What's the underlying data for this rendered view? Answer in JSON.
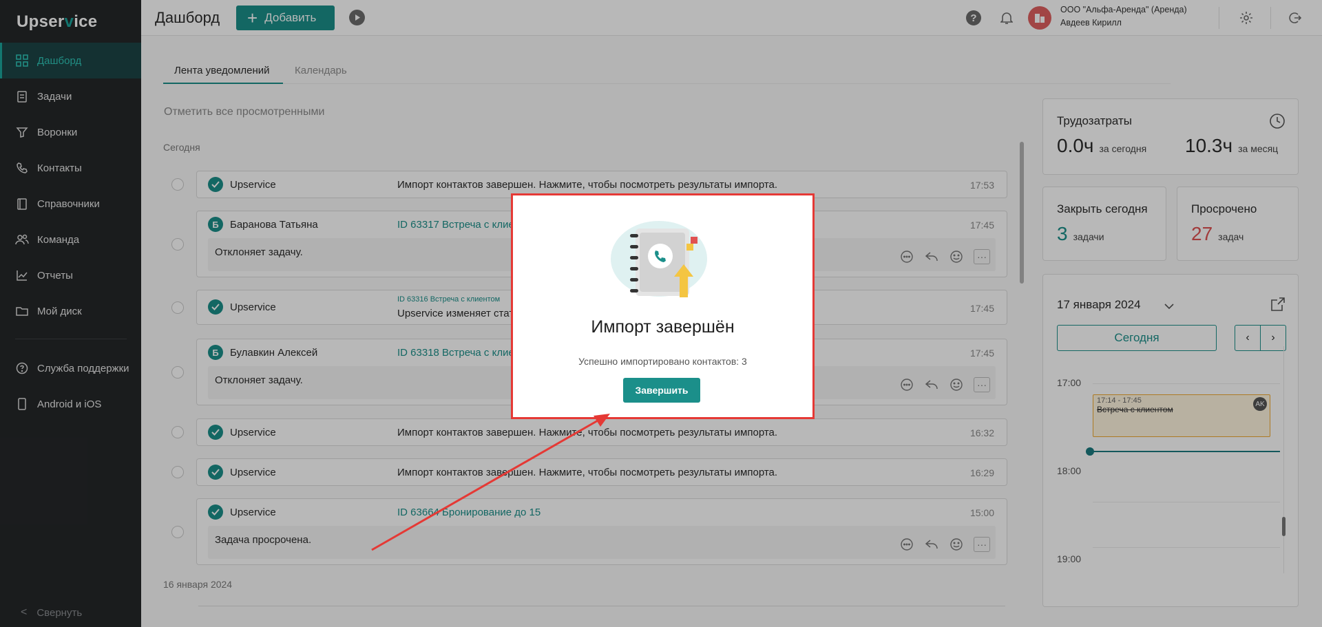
{
  "app": {
    "logo_prefix": "Upser",
    "logo_check": "v",
    "logo_suffix": "ice"
  },
  "sidebar": {
    "items": [
      {
        "label": "Дашборд"
      },
      {
        "label": "Задачи"
      },
      {
        "label": "Воронки"
      },
      {
        "label": "Контакты"
      },
      {
        "label": "Справочники"
      },
      {
        "label": "Команда"
      },
      {
        "label": "Отчеты"
      },
      {
        "label": "Мой диск"
      },
      {
        "label": "Служба поддержки"
      },
      {
        "label": "Android и iOS"
      }
    ],
    "collapse_label": "Свернуть",
    "collapse_arrow": "<"
  },
  "header": {
    "title": "Дашборд",
    "add_label": "Добавить",
    "add_plus": "+",
    "help_glyph": "?",
    "org_name": "ООО \"Альфа-Аренда\" (Аренда)",
    "user_name": "Авдеев Кирилл"
  },
  "tabs": [
    {
      "label": "Лента уведомлений"
    },
    {
      "label": "Календарь"
    }
  ],
  "feed": {
    "mark_all_label": "Отметить все просмотренными",
    "group_today": "Сегодня",
    "group_prev": "16 января 2024",
    "items": [
      {
        "sender": "Upservice",
        "message": "Импорт контактов завершен. Нажмите, чтобы посмотреть результаты импорта.",
        "time": "17:53"
      },
      {
        "sender_initial": "Б",
        "sender": "Баранова Татьяна",
        "message": "ID 63317 Встреча с клие",
        "time": "17:45",
        "body": "Отклоняет задачу."
      },
      {
        "sender": "Upservice",
        "sub": "ID 63316 Встреча с клиентом",
        "message": "Upservice изменяет стат",
        "time": "17:45"
      },
      {
        "sender_initial": "Б",
        "sender": "Булавкин Алексей",
        "message": "ID 63318 Встреча с клие",
        "time": "17:45",
        "body": "Отклоняет задачу."
      },
      {
        "sender": "Upservice",
        "message": "Импорт контактов завершен. Нажмите, чтобы посмотреть результаты импорта.",
        "time": "16:32"
      },
      {
        "sender": "Upservice",
        "message": "Импорт контактов завершен. Нажмите, чтобы посмотреть результаты импорта.",
        "time": "16:29"
      },
      {
        "sender": "Upservice",
        "message": "ID 63664 Бронирование до 15",
        "time": "15:00",
        "body": "Задача просрочена."
      }
    ],
    "more_glyph": "···"
  },
  "widgets": {
    "labor": {
      "title": "Трудозатраты",
      "today_value": "0.0ч",
      "today_label": "за сегодня",
      "month_value": "10.3ч",
      "month_label": "за месяц"
    },
    "close_today": {
      "title": "Закрыть сегодня",
      "value": "3",
      "unit": "задачи"
    },
    "overdue": {
      "title": "Просрочено",
      "value": "27",
      "unit": "задач"
    },
    "calendar": {
      "date": "17 января 2024",
      "today_label": "Сегодня",
      "prev_glyph": "‹",
      "next_glyph": "›",
      "hours": [
        "17:00",
        "18:00",
        "19:00"
      ],
      "event": {
        "time": "17:14 - 17:45",
        "title": "Встреча с клиентом",
        "badge": "AK"
      }
    }
  },
  "modal": {
    "title": "Импорт завершён",
    "text": "Успешно импортировано контактов: 3",
    "button": "Завершить"
  },
  "colors": {
    "accent": "#1b8f8a",
    "sidebar_bg": "#252729",
    "overdue": "#e05252",
    "modal_border": "#e53935"
  }
}
